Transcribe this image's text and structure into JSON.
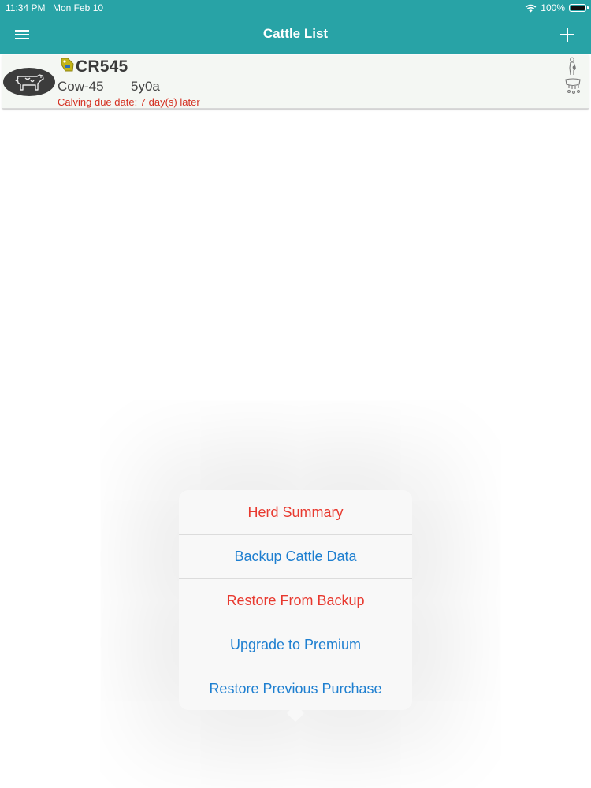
{
  "status_bar": {
    "time": "11:34 PM",
    "date": "Mon Feb 10",
    "battery": "100%",
    "wifi_icon": "wifi-icon",
    "battery_icon": "battery-icon"
  },
  "nav": {
    "title": "Cattle List",
    "menu_icon": "hamburger-menu-icon",
    "add_icon": "plus-icon",
    "background": "#28a3a6"
  },
  "cattle_list": [
    {
      "id": "CR545",
      "name": "Cow-45",
      "age": "5y0a",
      "note": "Calving due date: 7 day(s) later",
      "avatar_icon": "cow-icon",
      "tag_icon": "ear-tag-icon",
      "status_icons": [
        "pregnant-icon",
        "milking-icon"
      ]
    }
  ],
  "popover_menu": {
    "items": [
      {
        "label": "Herd Summary",
        "color": "#e8392f"
      },
      {
        "label": "Backup Cattle Data",
        "color": "#1e7fd0"
      },
      {
        "label": "Restore From Backup",
        "color": "#e8392f"
      },
      {
        "label": "Upgrade to Premium",
        "color": "#1e7fd0"
      },
      {
        "label": "Restore Previous Purchase",
        "color": "#1e7fd0"
      }
    ]
  }
}
